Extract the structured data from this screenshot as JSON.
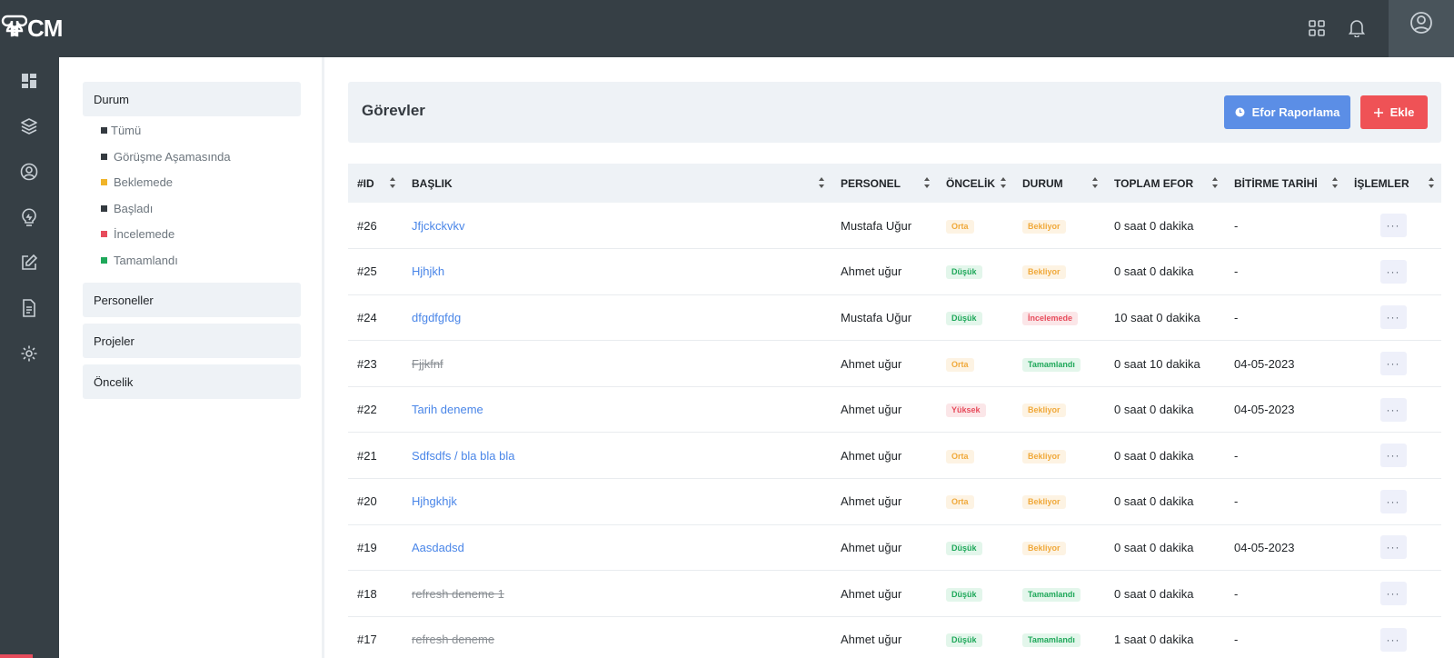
{
  "brand": {
    "logo_text": "CM"
  },
  "colors": {
    "topbar": "#363f45",
    "accent_blue": "#5b8ee6",
    "accent_red": "#ef5256",
    "link": "#4a86e8"
  },
  "topbar_icons": [
    "apps-grid-icon",
    "bell-icon",
    "user-circle-icon"
  ],
  "rail_icons": [
    "dashboard-icon",
    "layers-icon",
    "user-icon",
    "lightbulb-icon",
    "edit-icon",
    "document-icon",
    "settings-icon"
  ],
  "filters": {
    "durum_label": "Durum",
    "status_options": [
      {
        "label": "Tümü",
        "color": "#343a40"
      },
      {
        "label": "Görüşme Aşamasında",
        "color": "#343a40"
      },
      {
        "label": "Beklemede",
        "color": "#f0b429"
      },
      {
        "label": "Başladı",
        "color": "#343a40"
      },
      {
        "label": "İncelemede",
        "color": "#e74c5c"
      },
      {
        "label": "Tamamlandı",
        "color": "#1fa85a"
      }
    ],
    "personeller_label": "Personeller",
    "projeler_label": "Projeler",
    "oncelik_label": "Öncelik"
  },
  "header": {
    "title": "Görevler",
    "efor_button": "Efor Raporlama",
    "ekle_button": "Ekle"
  },
  "table": {
    "columns": [
      "#ID",
      "BAŞLIK",
      "PERSONEL",
      "ÖNCELİK",
      "DURUM",
      "TOPLAM EFOR",
      "BİTİRME TARİHİ",
      "İŞLEMLER"
    ],
    "rows": [
      {
        "id": "#26",
        "title": "Jfjckckvkv",
        "done": false,
        "person": "Mustafa Uğur",
        "priority": "Orta",
        "priority_class": "b-orta",
        "status": "Bekliyor",
        "status_class": "b-bekliyor",
        "effort": "0 saat 0 dakika",
        "due": "-"
      },
      {
        "id": "#25",
        "title": "Hjhjkh",
        "done": false,
        "person": "Ahmet uğur",
        "priority": "Düşük",
        "priority_class": "b-dusuk",
        "status": "Bekliyor",
        "status_class": "b-bekliyor",
        "effort": "0 saat 0 dakika",
        "due": "-"
      },
      {
        "id": "#24",
        "title": "dfgdfgfdg",
        "done": false,
        "person": "Mustafa Uğur",
        "priority": "Düşük",
        "priority_class": "b-dusuk",
        "status": "İncelemede",
        "status_class": "b-incele",
        "effort": "10 saat 0 dakika",
        "due": "-"
      },
      {
        "id": "#23",
        "title": "Fjjkfnf",
        "done": true,
        "person": "Ahmet uğur",
        "priority": "Orta",
        "priority_class": "b-orta",
        "status": "Tamamlandı",
        "status_class": "b-tamam",
        "effort": "0 saat 10 dakika",
        "due": "04-05-2023"
      },
      {
        "id": "#22",
        "title": "Tarih deneme",
        "done": false,
        "person": "Ahmet uğur",
        "priority": "Yüksek",
        "priority_class": "b-yuksek",
        "status": "Bekliyor",
        "status_class": "b-bekliyor",
        "effort": "0 saat 0 dakika",
        "due": "04-05-2023"
      },
      {
        "id": "#21",
        "title": "Sdfsdfs / bla bla bla",
        "done": false,
        "person": "Ahmet uğur",
        "priority": "Orta",
        "priority_class": "b-orta",
        "status": "Bekliyor",
        "status_class": "b-bekliyor",
        "effort": "0 saat 0 dakika",
        "due": "-"
      },
      {
        "id": "#20",
        "title": "Hjhgkhjk",
        "done": false,
        "person": "Ahmet uğur",
        "priority": "Orta",
        "priority_class": "b-orta",
        "status": "Bekliyor",
        "status_class": "b-bekliyor",
        "effort": "0 saat 0 dakika",
        "due": "-"
      },
      {
        "id": "#19",
        "title": "Aasdadsd",
        "done": false,
        "person": "Ahmet uğur",
        "priority": "Düşük",
        "priority_class": "b-dusuk",
        "status": "Bekliyor",
        "status_class": "b-bekliyor",
        "effort": "0 saat 0 dakika",
        "due": "04-05-2023"
      },
      {
        "id": "#18",
        "title": "refresh deneme 1",
        "done": true,
        "person": "Ahmet uğur",
        "priority": "Düşük",
        "priority_class": "b-dusuk",
        "status": "Tamamlandı",
        "status_class": "b-tamam",
        "effort": "0 saat 0 dakika",
        "due": "-"
      },
      {
        "id": "#17",
        "title": "refresh deneme",
        "done": true,
        "person": "Ahmet uğur",
        "priority": "Düşük",
        "priority_class": "b-dusuk",
        "status": "Tamamlandı",
        "status_class": "b-tamam",
        "effort": "1 saat 0 dakika",
        "due": "-"
      }
    ],
    "actions_label": "···"
  }
}
